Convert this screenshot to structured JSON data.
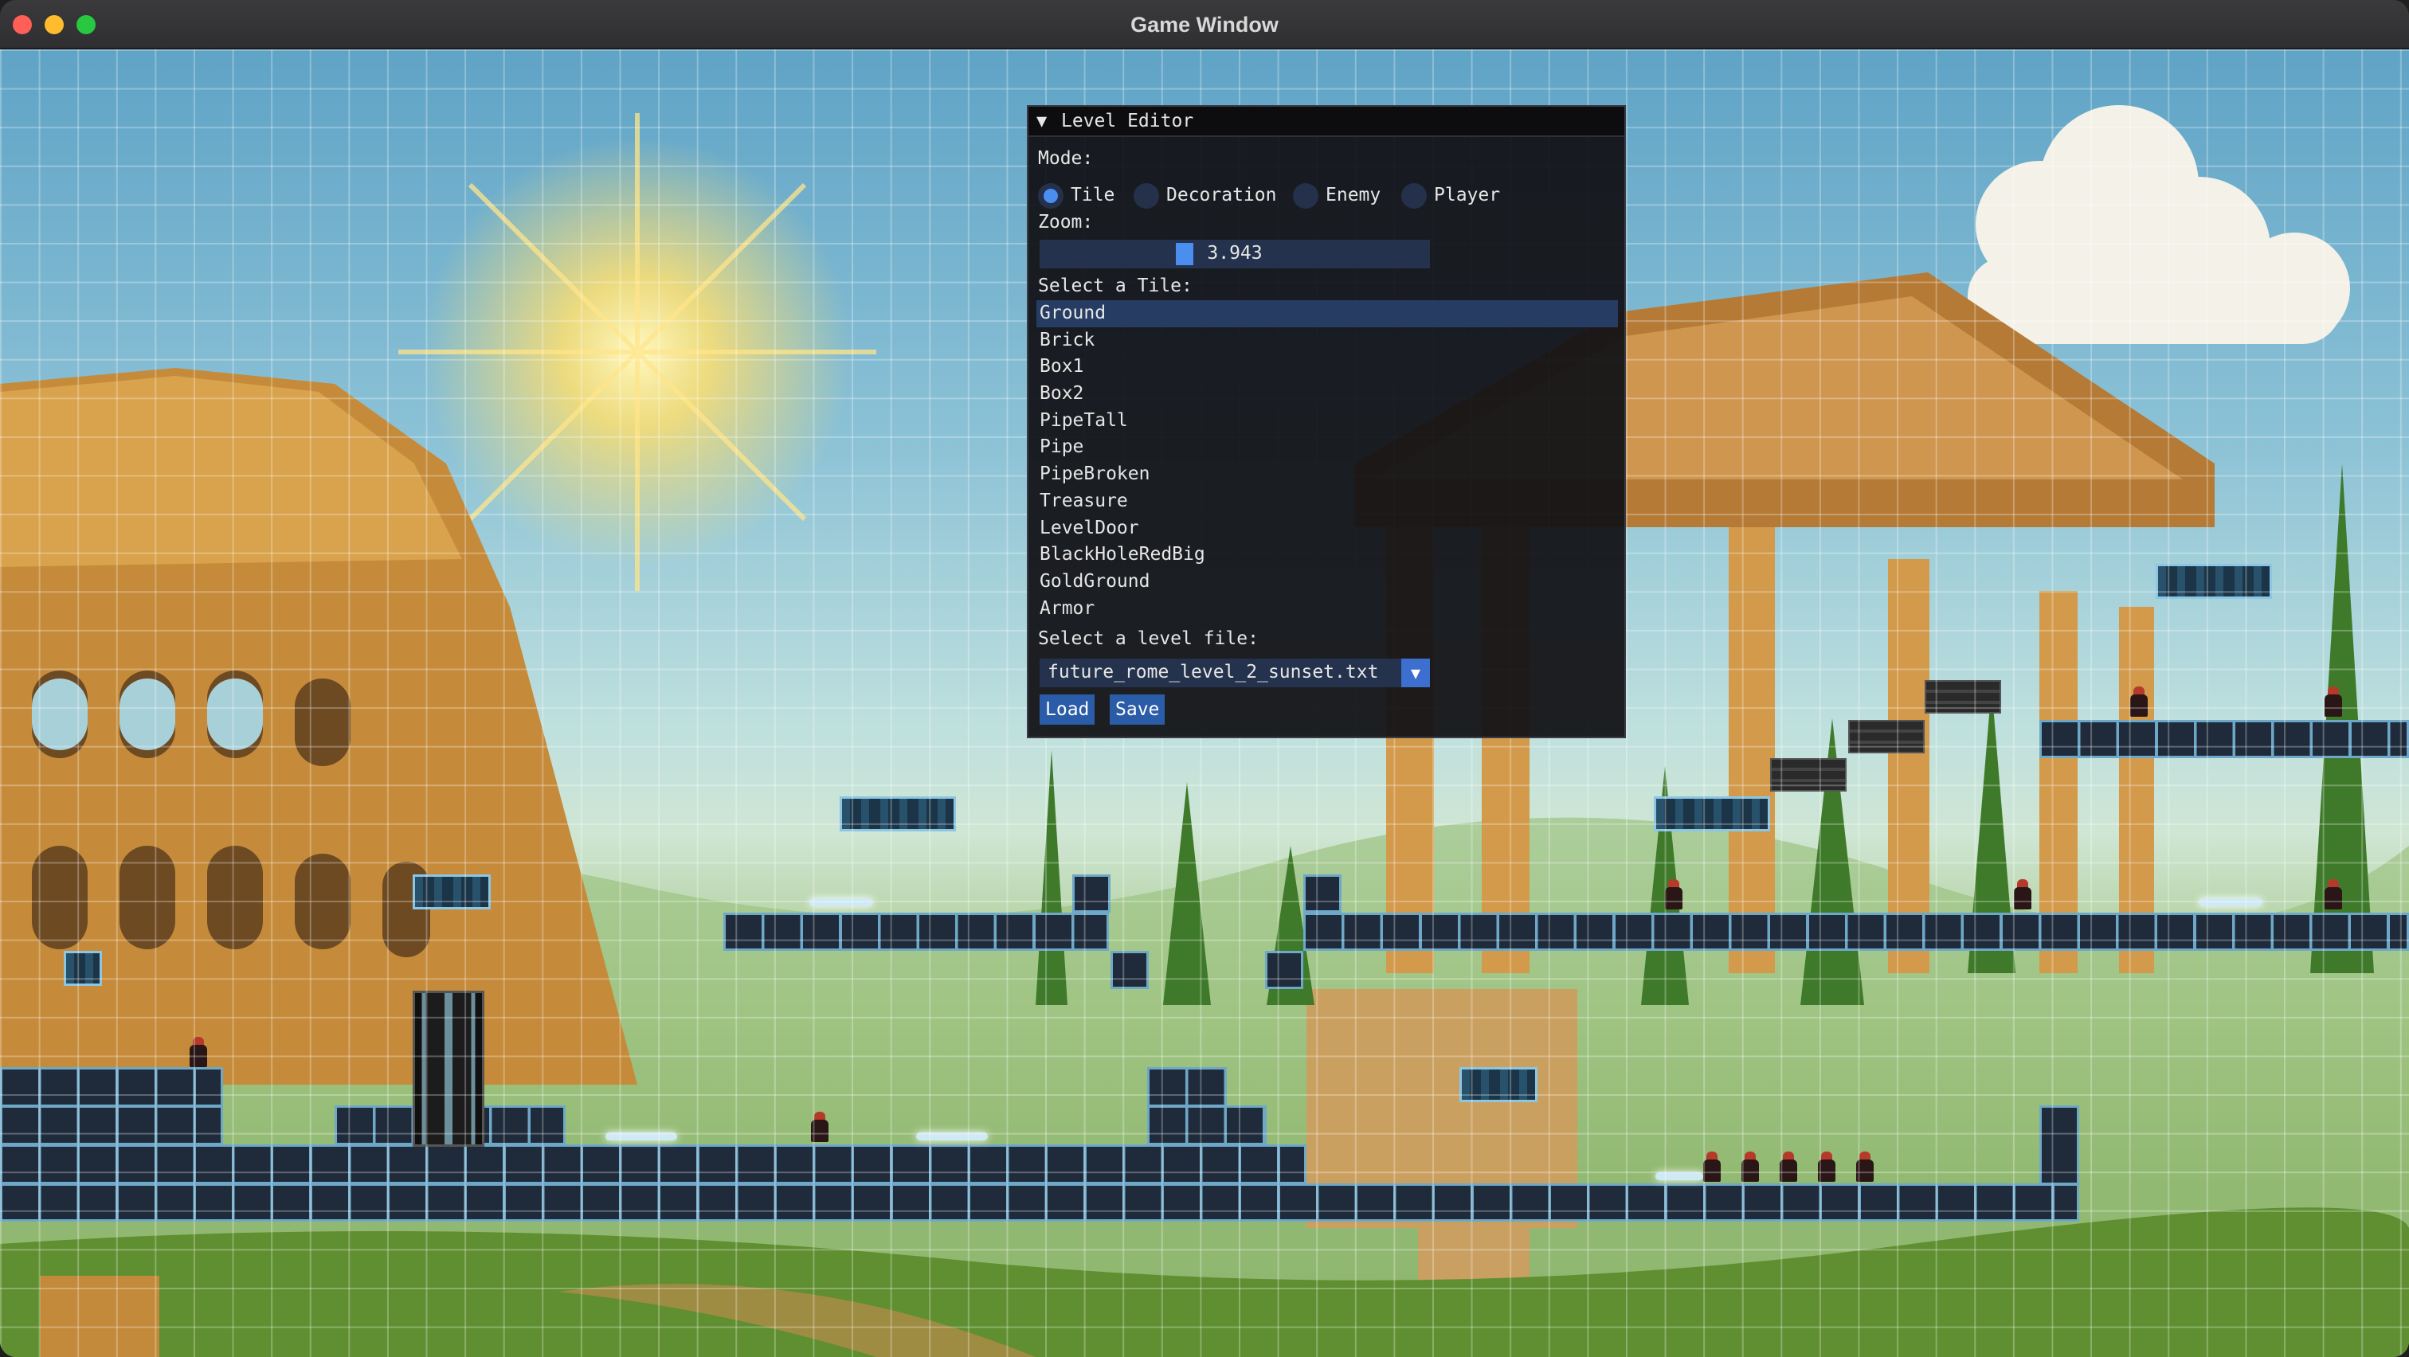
{
  "window": {
    "title": "Game Window"
  },
  "editor": {
    "title": "Level Editor",
    "mode_label": "Mode:",
    "modes": [
      {
        "label": "Tile",
        "selected": true
      },
      {
        "label": "Decoration",
        "selected": false
      },
      {
        "label": "Enemy",
        "selected": false
      },
      {
        "label": "Player",
        "selected": false
      }
    ],
    "zoom_label": "Zoom:",
    "zoom_value": "3.943",
    "tile_label": "Select a Tile:",
    "tiles": [
      "Ground",
      "Brick",
      "Box1",
      "Box2",
      "PipeTall",
      "Pipe",
      "PipeBroken",
      "Treasure",
      "LevelDoor",
      "BlackHoleRedBig",
      "GoldGround",
      "Armor"
    ],
    "selected_tile": "Ground",
    "file_label": "Select a level file:",
    "file_value": "future_rome_level_2_sunset.txt",
    "load_label": "Load",
    "save_label": "Save"
  },
  "colors": {
    "accent": "#4a8ef0",
    "panel_bg": "#121216",
    "tile_border": "#6ea8c8"
  }
}
